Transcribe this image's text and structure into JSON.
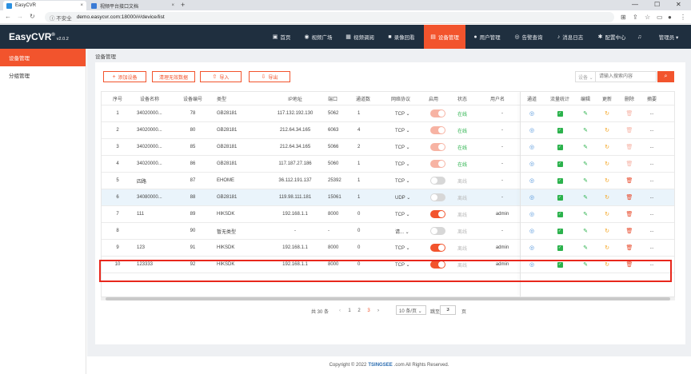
{
  "browser": {
    "tabs": [
      {
        "title": "EasyCVR",
        "close": "×"
      },
      {
        "title": "视频平台接口文档",
        "close": "×"
      }
    ],
    "new_tab": "+",
    "controls": {
      "min": "—",
      "max": "☐",
      "close": "✕"
    },
    "security": "ⓘ 不安全",
    "url": "demo.easycvr.com:18000/#/device/list"
  },
  "app": {
    "logo": "EasyCVR",
    "logo_sup": "®",
    "version": "v2.0.2",
    "nav": [
      {
        "label": "首页",
        "icon": "▣"
      },
      {
        "label": "视频广场",
        "icon": "◉"
      },
      {
        "label": "视频调阅",
        "icon": "▦"
      },
      {
        "label": "录像回看",
        "icon": "■"
      },
      {
        "label": "设备管理",
        "icon": "▤"
      },
      {
        "label": "用户管理",
        "icon": "●"
      },
      {
        "label": "告警查询",
        "icon": "◎"
      },
      {
        "label": "消息日志",
        "icon": "♪"
      },
      {
        "label": "配置中心",
        "icon": "✱"
      },
      {
        "label": "",
        "icon": "♫"
      },
      {
        "label": "管理员 ▾",
        "icon": ""
      }
    ]
  },
  "sidebar": {
    "items": [
      {
        "label": "设备管理",
        "active": true
      },
      {
        "label": "分组管理",
        "active": false
      }
    ]
  },
  "breadcrumb": "设备管理",
  "toolbar": {
    "add": "添加设备",
    "clear": "清理无效数据",
    "import": "导入",
    "export": "导出",
    "select_value": "设备 ⌄",
    "search_placeholder": "请输入搜索内容",
    "search_icon": "⌕"
  },
  "table": {
    "headers": [
      "序号",
      "设备名称",
      "设备编号",
      "类型",
      "IP地址",
      "端口",
      "通道数",
      "网络协议",
      "启用",
      "状态",
      "用户名",
      "通道",
      "流量统计",
      "编辑",
      "更新",
      "删除",
      "摘要"
    ],
    "rows": [
      {
        "no": "1",
        "name": "34020000...",
        "code": "78",
        "type": "GB28181",
        "ip": "117.132.192.130",
        "port": "5062",
        "channels": "1",
        "proto": "TCP ⌄",
        "enabled": "on-dim",
        "status": "在线",
        "status_class": "st-on",
        "user": "-",
        "del": "dim",
        "highlight": false
      },
      {
        "no": "2",
        "name": "34020000...",
        "code": "80",
        "type": "GB28181",
        "ip": "212.64.34.165",
        "port": "6063",
        "channels": "4",
        "proto": "TCP ⌄",
        "enabled": "on-dim",
        "status": "在线",
        "status_class": "st-on",
        "user": "-",
        "del": "dim",
        "highlight": false
      },
      {
        "no": "3",
        "name": "34020000...",
        "code": "85",
        "type": "GB28181",
        "ip": "212.64.34.165",
        "port": "5066",
        "channels": "2",
        "proto": "TCP ⌄",
        "enabled": "on-dim",
        "status": "在线",
        "status_class": "st-on",
        "user": "-",
        "del": "dim",
        "highlight": false
      },
      {
        "no": "4",
        "name": "34020000...",
        "code": "86",
        "type": "GB28181",
        "ip": "117.187.27.186",
        "port": "5060",
        "channels": "1",
        "proto": "TCP ⌄",
        "enabled": "on-dim",
        "status": "在线",
        "status_class": "st-on",
        "user": "-",
        "del": "dim",
        "highlight": false
      },
      {
        "no": "5",
        "name": "四路",
        "code": "87",
        "type": "EHOME",
        "ip": "36.112.191.137",
        "port": "25392",
        "channels": "1",
        "proto": "TCP ⌄",
        "enabled": "off",
        "status": "离线",
        "status_class": "st-off",
        "user": "-",
        "del": "",
        "highlight": false
      },
      {
        "no": "6",
        "name": "34080000...",
        "code": "88",
        "type": "GB28181",
        "ip": "119.98.111.181",
        "port": "15061",
        "channels": "1",
        "proto": "UDP ⌄",
        "enabled": "off",
        "status": "离线",
        "status_class": "st-off",
        "user": "-",
        "del": "",
        "highlight": true
      },
      {
        "no": "7",
        "name": "111",
        "code": "89",
        "type": "HIKSDK",
        "ip": "192.168.1.1",
        "port": "8000",
        "channels": "0",
        "proto": "TCP ⌄",
        "enabled": "on",
        "status": "离线",
        "status_class": "st-off",
        "user": "admin",
        "del": "",
        "highlight": false
      },
      {
        "no": "8",
        "name": "",
        "code": "90",
        "type": "暂无类型",
        "ip": "-",
        "port": "-",
        "channels": "0",
        "proto": "请... ⌄",
        "enabled": "off",
        "status": "离线",
        "status_class": "st-off",
        "user": "-",
        "del": "",
        "highlight": false
      },
      {
        "no": "9",
        "name": "123",
        "code": "91",
        "type": "HIKSDK",
        "ip": "192.168.1.1",
        "port": "8000",
        "channels": "0",
        "proto": "TCP ⌄",
        "enabled": "on",
        "status": "离线",
        "status_class": "st-off",
        "user": "admin",
        "del": "",
        "highlight": false
      },
      {
        "no": "10",
        "name": "123333",
        "code": "92",
        "type": "HIKSDK",
        "ip": "192.168.1.1",
        "port": "8000",
        "channels": "0",
        "proto": "TCP ⌄",
        "enabled": "on",
        "status": "离线",
        "status_class": "st-off",
        "user": "admin",
        "del": "",
        "highlight": false
      }
    ],
    "icons": {
      "channel": "◎",
      "flow": "✓",
      "edit": "✎",
      "update": "↻",
      "delete": "🗑",
      "more": "..."
    }
  },
  "pagination": {
    "total": "共 30 条",
    "prev": "‹",
    "pages": [
      "1",
      "2",
      "3"
    ],
    "active_page": "3",
    "next": "›",
    "page_size": "10 条/页 ⌄",
    "goto_label": "跳至",
    "goto_value": "3",
    "goto_suffix": "页"
  },
  "footer": {
    "prefix": "Copyright © 2022",
    "brand": "TSINGSEE",
    "suffix": ".com All Rights Reserved."
  }
}
